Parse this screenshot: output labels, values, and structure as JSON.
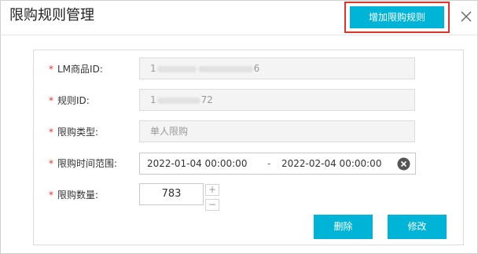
{
  "dialog": {
    "title": "限购规则管理",
    "add_rule_label": "增加限购规则"
  },
  "form": {
    "required_mark": "*",
    "lm_product_id": {
      "label": "LM商品ID:",
      "value_start": "1",
      "value_end": "6"
    },
    "rule_id": {
      "label": "规则ID:",
      "value_start": "1",
      "value_end": "72"
    },
    "limit_type": {
      "label": "限购类型:",
      "value": "单人限购"
    },
    "time_range": {
      "label": "限购时间范围:",
      "start": "2022-01-04 00:00:00",
      "separator": "-",
      "end": "2022-02-04 00:00:00"
    },
    "quantity": {
      "label": "限购数量:",
      "value": "783",
      "increment": "+",
      "decrement": "−"
    }
  },
  "actions": {
    "delete_label": "删除",
    "modify_label": "修改"
  },
  "colors": {
    "accent": "#00b4d8",
    "highlight_border": "#e0342a",
    "required": "#e0342a"
  }
}
